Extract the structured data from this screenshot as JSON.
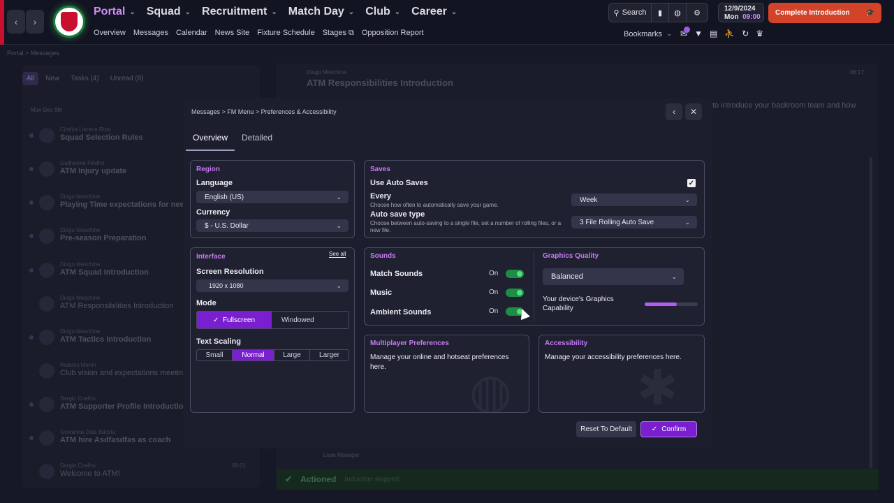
{
  "header": {
    "menu": [
      {
        "label": "Portal"
      },
      {
        "label": "Squad"
      },
      {
        "label": "Recruitment"
      },
      {
        "label": "Match Day"
      },
      {
        "label": "Club"
      },
      {
        "label": "Career"
      }
    ],
    "submenu": [
      "Overview",
      "Messages",
      "Calendar",
      "News Site",
      "Fixture Schedule",
      "Stages",
      "Opposition Report"
    ],
    "search_label": "Search",
    "date": "12/9/2024",
    "day": "Mon",
    "time": "09:00",
    "complete_label": "Complete Introduction",
    "bookmarks_label": "Bookmarks"
  },
  "background": {
    "breadcrumb": "Portal > Messages",
    "filters": [
      "All",
      "New",
      "Tasks (4)",
      "Unread (8)"
    ],
    "list_date": "Mon Dec 9th",
    "messages": [
      {
        "sender": "Cinthia Llerena Rios",
        "subject": "Squad Selection Rules"
      },
      {
        "sender": "Guilherme Findho",
        "subject": "ATM Injury update"
      },
      {
        "sender": "Diogo Meschine",
        "subject": "Playing Time expectations for new"
      },
      {
        "sender": "Diogo Meschine",
        "subject": "Pre-season Preparation"
      },
      {
        "sender": "Diogo Meschine",
        "subject": "ATM Squad Introduction"
      },
      {
        "sender": "Diogo Meschine",
        "subject": "ATM Responsibilities Introduction"
      },
      {
        "sender": "Diogo Meschine",
        "subject": "ATM Tactics Introduction"
      },
      {
        "sender": "Rubens Menin",
        "subject": "Club vision and expectations meeting"
      },
      {
        "sender": "Sergio Coelho",
        "subject": "ATM Supporter Profile Introduction"
      },
      {
        "sender": "Giovanna Dias Batista",
        "subject": "ATM hire Asdfasdfas as coach"
      },
      {
        "sender": "Sergio Coelho",
        "subject": "Welcome to ATM!"
      }
    ],
    "last_time": "08:01",
    "open_sender": "Diogo Meschine",
    "open_title": "ATM Responsibilities Introduction",
    "open_time": "08:17",
    "open_text": "to introduce your backroom team and how",
    "loan_manager": "Loan Manager",
    "actioned": "Actioned",
    "actioned_note": "Induction skipped"
  },
  "modal": {
    "breadcrumb": [
      "Messages",
      "FM Menu",
      "Preferences & Accessibility"
    ],
    "tabs": [
      "Overview",
      "Detailed"
    ],
    "region": {
      "title": "Region",
      "language_label": "Language",
      "language_value": "English (US)",
      "currency_label": "Currency",
      "currency_value": "$ - U.S. Dollar"
    },
    "saves": {
      "title": "Saves",
      "auto_label": "Use Auto Saves",
      "auto_checked": true,
      "every_label": "Every",
      "every_hint": "Choose how often to automatically save your game.",
      "every_value": "Week",
      "type_label": "Auto save type",
      "type_hint": "Choose between auto-saving to a single file, set a number of rolling files, or a new file.",
      "type_value": "3 File Rolling Auto Save"
    },
    "interface": {
      "title": "Interface",
      "see_all": "See all",
      "resolution_label": "Screen Resolution",
      "resolution_value": "1920 x 1080",
      "mode_label": "Mode",
      "mode_options": [
        "Fullscreen",
        "Windowed"
      ],
      "mode_selected": "Fullscreen",
      "scaling_label": "Text Scaling",
      "scaling_options": [
        "Small",
        "Normal",
        "Large",
        "Larger"
      ],
      "scaling_selected": "Normal"
    },
    "sounds": {
      "title": "Sounds",
      "items": [
        {
          "label": "Match Sounds",
          "state": "On"
        },
        {
          "label": "Music",
          "state": "On"
        },
        {
          "label": "Ambient Sounds",
          "state": "On"
        }
      ]
    },
    "graphics": {
      "title": "Graphics Quality",
      "value": "Balanced",
      "capability_label": "Your device's Graphics Capability",
      "capability_level": 0.6
    },
    "multiplayer": {
      "title": "Multiplayer Preferences",
      "text": "Manage your online and hotseat preferences here."
    },
    "accessibility": {
      "title": "Accessibility",
      "text": "Manage your accessibility preferences here."
    },
    "reset_label": "Reset To Default",
    "confirm_label": "Confirm"
  },
  "colors": {
    "accent": "#7a1fcf",
    "heading": "#c77af3",
    "toggle_on": "#1f8c45",
    "complete": "#d2432a"
  }
}
